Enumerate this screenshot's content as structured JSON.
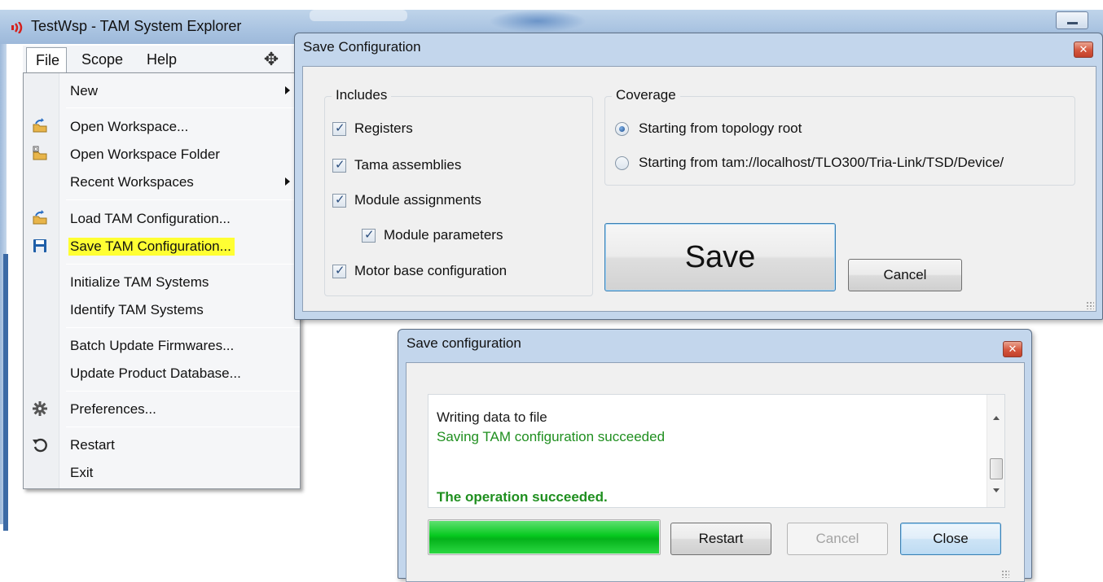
{
  "app": {
    "title": "TestWsp - TAM System Explorer",
    "menu": {
      "file": "File",
      "scope": "Scope",
      "help": "Help"
    }
  },
  "file_menu": {
    "new": "New",
    "open_workspace": "Open Workspace...",
    "open_workspace_folder": "Open Workspace Folder",
    "recent_workspaces": "Recent Workspaces",
    "load_tam_configuration": "Load TAM Configuration...",
    "save_tam_configuration": "Save TAM Configuration...",
    "initialize_tam_systems": "Initialize TAM Systems",
    "identify_tam_systems": "Identify TAM Systems",
    "batch_update_firmwares": "Batch Update Firmwares...",
    "update_product_database": "Update Product Database...",
    "preferences": "Preferences...",
    "restart": "Restart",
    "exit": "Exit"
  },
  "save_dialog": {
    "title": "Save Configuration",
    "includes": {
      "title": "Includes",
      "registers": "Registers",
      "tama_assemblies": "Tama assemblies",
      "module_assignments": "Module assignments",
      "module_parameters": "Module parameters",
      "motor_base_configuration": "Motor base configuration"
    },
    "coverage": {
      "title": "Coverage",
      "from_root": "Starting from topology root",
      "from_path": "Starting from tam://localhost/TLO300/Tria-Link/TSD/Device/",
      "selected": "from_root"
    },
    "save_label": "Save",
    "cancel_label": "Cancel"
  },
  "progress_dialog": {
    "title": "Save configuration",
    "log": {
      "line1": "Writing data to file",
      "line2": "Saving TAM configuration succeeded",
      "line3": "The operation succeeded."
    },
    "progress_fraction": 1.0,
    "restart_label": "Restart",
    "cancel_label": "Cancel",
    "close_label": "Close"
  },
  "colors": {
    "highlight": "#ffff33",
    "success_text": "#1f8f1f",
    "progress": "#06c91f",
    "accent": "#3c7fb1"
  }
}
